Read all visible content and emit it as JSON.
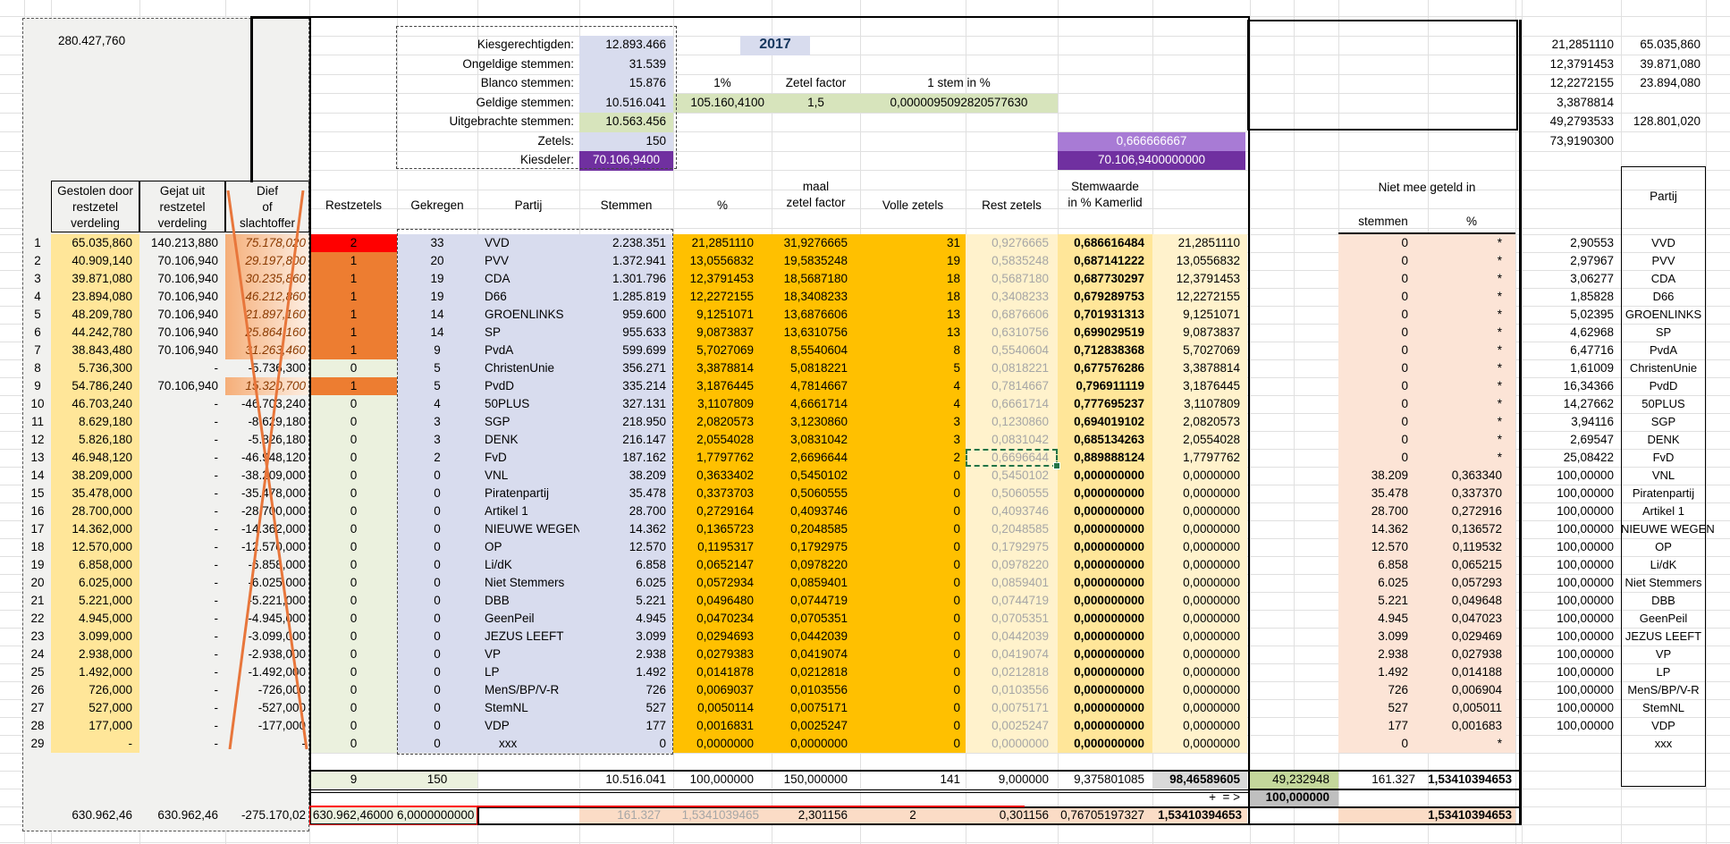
{
  "year": "2017",
  "top_left_value": "280.427,760",
  "info": {
    "rows": [
      {
        "label": "Kiesgerechtigden:",
        "value": "12.893.466",
        "bg": "lav"
      },
      {
        "label": "Ongeldige stemmen:",
        "value": "31.539",
        "bg": "lav"
      },
      {
        "label": "Blanco stemmen:",
        "value": "15.876",
        "bg": "lav"
      },
      {
        "label": "Geldige stemmen:",
        "value": "10.516.041",
        "bg": "lav"
      },
      {
        "label": "Uitgebrachte stemmen:",
        "value": "10.563.456",
        "bg": "green"
      },
      {
        "label": "Zetels:",
        "value": "150",
        "bg": "lav"
      },
      {
        "label": "Kiesdeler:",
        "value": "70.106,9400",
        "bg": "purple"
      }
    ],
    "pct_label": "1%",
    "pct_value": "105.160,4100",
    "factor_label": "Zetel factor",
    "factor_value": "1,5",
    "stem_label": "1 stem in %",
    "stem_value": "0,0000095092820577630",
    "purple_light": "0,666666667",
    "purple_dark": "70.106,9400000000"
  },
  "top_right": [
    [
      "21,2851110",
      "65.035,860"
    ],
    [
      "12,3791453",
      "39.871,080"
    ],
    [
      "12,2272155",
      "23.894,080"
    ],
    [
      "3,3878814",
      ""
    ],
    [
      "49,2793533",
      "128.801,020"
    ],
    [
      "73,9190300",
      ""
    ]
  ],
  "headers": {
    "left": [
      "Gestolen door\nrestzetel\nverdeling",
      "Gejat uit\nrestzetel\nverdeling",
      "Dief\nof\nslachtoffer"
    ],
    "restzetels": "Restzetels",
    "gekregen": "Gekregen",
    "partij": "Partij",
    "stemmen": "Stemmen",
    "pct": "%",
    "maal": "maal\nzetel factor",
    "volle": "Volle zetels",
    "rest": "Rest zetels",
    "stemwaarde": "Stemwaarde\nin % Kamerlid",
    "niet": "Niet mee geteld in",
    "niet_stemmen": "stemmen",
    "niet_pct": "%",
    "partij_right": "Partij"
  },
  "rows": [
    {
      "n": "1",
      "gestolen": "65.035,860",
      "gejat": "140.213,880",
      "dief": "75.178,020",
      "dief_bar": true,
      "restzetels": "2",
      "rz_color": "red",
      "gekregen": "33",
      "partij": "VVD",
      "stemmen": "2.238.351",
      "pct": "21,2851110",
      "maal": "31,9276665",
      "volle": "31",
      "rest": "0,9276665",
      "stemwaarde": "0,686616484",
      "pct2": "21,2851110",
      "nm_stemmen": "0",
      "nm_pct": "*",
      "num": "2,90553",
      "partij2": "VVD",
      "selected": false
    },
    {
      "n": "2",
      "gestolen": "40.909,140",
      "gejat": "70.106,940",
      "dief": "29.197,800",
      "dief_bar": true,
      "restzetels": "1",
      "rz_color": "orange",
      "gekregen": "20",
      "partij": "PVV",
      "stemmen": "1.372.941",
      "pct": "13,0556832",
      "maal": "19,5835248",
      "volle": "19",
      "rest": "0,5835248",
      "stemwaarde": "0,687141222",
      "pct2": "13,0556832",
      "nm_stemmen": "0",
      "nm_pct": "*",
      "num": "2,97967",
      "partij2": "PVV",
      "selected": false
    },
    {
      "n": "3",
      "gestolen": "39.871,080",
      "gejat": "70.106,940",
      "dief": "30.235,860",
      "dief_bar": true,
      "restzetels": "1",
      "rz_color": "orange",
      "gekregen": "19",
      "partij": "CDA",
      "stemmen": "1.301.796",
      "pct": "12,3791453",
      "maal": "18,5687180",
      "volle": "18",
      "rest": "0,5687180",
      "stemwaarde": "0,687730297",
      "pct2": "12,3791453",
      "nm_stemmen": "0",
      "nm_pct": "*",
      "num": "3,06277",
      "partij2": "CDA",
      "selected": false
    },
    {
      "n": "4",
      "gestolen": "23.894,080",
      "gejat": "70.106,940",
      "dief": "46.212,860",
      "dief_bar": true,
      "restzetels": "1",
      "rz_color": "orange",
      "gekregen": "19",
      "partij": "D66",
      "stemmen": "1.285.819",
      "pct": "12,2272155",
      "maal": "18,3408233",
      "volle": "18",
      "rest": "0,3408233",
      "stemwaarde": "0,679289753",
      "pct2": "12,2272155",
      "nm_stemmen": "0",
      "nm_pct": "*",
      "num": "1,85828",
      "partij2": "D66",
      "selected": false
    },
    {
      "n": "5",
      "gestolen": "48.209,780",
      "gejat": "70.106,940",
      "dief": "21.897,160",
      "dief_bar": true,
      "restzetels": "1",
      "rz_color": "orange",
      "gekregen": "14",
      "partij": "GROENLINKS",
      "stemmen": "959.600",
      "pct": "9,1251071",
      "maal": "13,6876606",
      "volle": "13",
      "rest": "0,6876606",
      "stemwaarde": "0,701931313",
      "pct2": "9,1251071",
      "nm_stemmen": "0",
      "nm_pct": "*",
      "num": "5,02395",
      "partij2": "GROENLINKS",
      "selected": false
    },
    {
      "n": "6",
      "gestolen": "44.242,780",
      "gejat": "70.106,940",
      "dief": "25.864,160",
      "dief_bar": true,
      "restzetels": "1",
      "rz_color": "orange",
      "gekregen": "14",
      "partij": "SP",
      "stemmen": "955.633",
      "pct": "9,0873837",
      "maal": "13,6310756",
      "volle": "13",
      "rest": "0,6310756",
      "stemwaarde": "0,699029519",
      "pct2": "9,0873837",
      "nm_stemmen": "0",
      "nm_pct": "*",
      "num": "4,62968",
      "partij2": "SP",
      "selected": false
    },
    {
      "n": "7",
      "gestolen": "38.843,480",
      "gejat": "70.106,940",
      "dief": "31.263,460",
      "dief_bar": true,
      "restzetels": "1",
      "rz_color": "orange",
      "gekregen": "9",
      "partij": "PvdA",
      "stemmen": "599.699",
      "pct": "5,7027069",
      "maal": "8,5540604",
      "volle": "8",
      "rest": "0,5540604",
      "stemwaarde": "0,712838368",
      "pct2": "5,7027069",
      "nm_stemmen": "0",
      "nm_pct": "*",
      "num": "6,47716",
      "partij2": "PvdA",
      "selected": false
    },
    {
      "n": "8",
      "gestolen": "5.736,300",
      "gejat": "-",
      "dief": "-5.736,300",
      "dief_bar": false,
      "restzetels": "0",
      "rz_color": "green",
      "gekregen": "5",
      "partij": "ChristenUnie",
      "stemmen": "356.271",
      "pct": "3,3878814",
      "maal": "5,0818221",
      "volle": "5",
      "rest": "0,0818221",
      "stemwaarde": "0,677576286",
      "pct2": "3,3878814",
      "nm_stemmen": "0",
      "nm_pct": "*",
      "num": "1,61009",
      "partij2": "ChristenUnie",
      "selected": false
    },
    {
      "n": "9",
      "gestolen": "54.786,240",
      "gejat": "70.106,940",
      "dief": "15.320,700",
      "dief_bar": true,
      "restzetels": "1",
      "rz_color": "orange",
      "gekregen": "5",
      "partij": "PvdD",
      "stemmen": "335.214",
      "pct": "3,1876445",
      "maal": "4,7814667",
      "volle": "4",
      "rest": "0,7814667",
      "stemwaarde": "0,796911119",
      "pct2": "3,1876445",
      "nm_stemmen": "0",
      "nm_pct": "*",
      "num": "16,34366",
      "partij2": "PvdD",
      "selected": false
    },
    {
      "n": "10",
      "gestolen": "46.703,240",
      "gejat": "-",
      "dief": "-46.703,240",
      "dief_bar": false,
      "restzetels": "0",
      "rz_color": "green",
      "gekregen": "4",
      "partij": "50PLUS",
      "stemmen": "327.131",
      "pct": "3,1107809",
      "maal": "4,6661714",
      "volle": "4",
      "rest": "0,6661714",
      "stemwaarde": "0,777695237",
      "pct2": "3,1107809",
      "nm_stemmen": "0",
      "nm_pct": "*",
      "num": "14,27662",
      "partij2": "50PLUS",
      "selected": false
    },
    {
      "n": "11",
      "gestolen": "8.629,180",
      "gejat": "-",
      "dief": "-8.629,180",
      "dief_bar": false,
      "restzetels": "0",
      "rz_color": "green",
      "gekregen": "3",
      "partij": "SGP",
      "stemmen": "218.950",
      "pct": "2,0820573",
      "maal": "3,1230860",
      "volle": "3",
      "rest": "0,1230860",
      "stemwaarde": "0,694019102",
      "pct2": "2,0820573",
      "nm_stemmen": "0",
      "nm_pct": "*",
      "num": "3,94116",
      "partij2": "SGP",
      "selected": false
    },
    {
      "n": "12",
      "gestolen": "5.826,180",
      "gejat": "-",
      "dief": "-5.826,180",
      "dief_bar": false,
      "restzetels": "0",
      "rz_color": "green",
      "gekregen": "3",
      "partij": "DENK",
      "stemmen": "216.147",
      "pct": "2,0554028",
      "maal": "3,0831042",
      "volle": "3",
      "rest": "0,0831042",
      "stemwaarde": "0,685134263",
      "pct2": "2,0554028",
      "nm_stemmen": "0",
      "nm_pct": "*",
      "num": "2,69547",
      "partij2": "DENK",
      "selected": false
    },
    {
      "n": "13",
      "gestolen": "46.948,120",
      "gejat": "-",
      "dief": "-46.948,120",
      "dief_bar": false,
      "restzetels": "0",
      "rz_color": "green",
      "gekregen": "2",
      "partij": "FvD",
      "stemmen": "187.162",
      "pct": "1,7797762",
      "maal": "2,6696644",
      "volle": "2",
      "rest": "0,6696644",
      "stemwaarde": "0,889888124",
      "pct2": "1,7797762",
      "nm_stemmen": "0",
      "nm_pct": "*",
      "num": "25,08422",
      "partij2": "FvD",
      "selected": true
    },
    {
      "n": "14",
      "gestolen": "38.209,000",
      "gejat": "-",
      "dief": "-38.209,000",
      "dief_bar": false,
      "restzetels": "0",
      "rz_color": "green",
      "gekregen": "0",
      "partij": "VNL",
      "stemmen": "38.209",
      "pct": "0,3633402",
      "maal": "0,5450102",
      "volle": "0",
      "rest": "0,5450102",
      "stemwaarde": "0,000000000",
      "pct2": "0,0000000",
      "nm_stemmen": "38.209",
      "nm_pct": "0,363340",
      "num": "100,00000",
      "partij2": "VNL",
      "selected": false
    },
    {
      "n": "15",
      "gestolen": "35.478,000",
      "gejat": "-",
      "dief": "-35.478,000",
      "dief_bar": false,
      "restzetels": "0",
      "rz_color": "green",
      "gekregen": "0",
      "partij": "Piratenpartij",
      "stemmen": "35.478",
      "pct": "0,3373703",
      "maal": "0,5060555",
      "volle": "0",
      "rest": "0,5060555",
      "stemwaarde": "0,000000000",
      "pct2": "0,0000000",
      "nm_stemmen": "35.478",
      "nm_pct": "0,337370",
      "num": "100,00000",
      "partij2": "Piratenpartij",
      "selected": false
    },
    {
      "n": "16",
      "gestolen": "28.700,000",
      "gejat": "-",
      "dief": "-28.700,000",
      "dief_bar": false,
      "restzetels": "0",
      "rz_color": "green",
      "gekregen": "0",
      "partij": "Artikel 1",
      "stemmen": "28.700",
      "pct": "0,2729164",
      "maal": "0,4093746",
      "volle": "0",
      "rest": "0,4093746",
      "stemwaarde": "0,000000000",
      "pct2": "0,0000000",
      "nm_stemmen": "28.700",
      "nm_pct": "0,272916",
      "num": "100,00000",
      "partij2": "Artikel 1",
      "selected": false
    },
    {
      "n": "17",
      "gestolen": "14.362,000",
      "gejat": "-",
      "dief": "-14.362,000",
      "dief_bar": false,
      "restzetels": "0",
      "rz_color": "green",
      "gekregen": "0",
      "partij": "NIEUWE WEGEN",
      "stemmen": "14.362",
      "pct": "0,1365723",
      "maal": "0,2048585",
      "volle": "0",
      "rest": "0,2048585",
      "stemwaarde": "0,000000000",
      "pct2": "0,0000000",
      "nm_stemmen": "14.362",
      "nm_pct": "0,136572",
      "num": "100,00000",
      "partij2": "NIEUWE WEGEN",
      "selected": false
    },
    {
      "n": "18",
      "gestolen": "12.570,000",
      "gejat": "-",
      "dief": "-12.570,000",
      "dief_bar": false,
      "restzetels": "0",
      "rz_color": "green",
      "gekregen": "0",
      "partij": "OP",
      "stemmen": "12.570",
      "pct": "0,1195317",
      "maal": "0,1792975",
      "volle": "0",
      "rest": "0,1792975",
      "stemwaarde": "0,000000000",
      "pct2": "0,0000000",
      "nm_stemmen": "12.570",
      "nm_pct": "0,119532",
      "num": "100,00000",
      "partij2": "OP",
      "selected": false
    },
    {
      "n": "19",
      "gestolen": "6.858,000",
      "gejat": "-",
      "dief": "-6.858,000",
      "dief_bar": false,
      "restzetels": "0",
      "rz_color": "green",
      "gekregen": "0",
      "partij": "Li/dK",
      "stemmen": "6.858",
      "pct": "0,0652147",
      "maal": "0,0978220",
      "volle": "0",
      "rest": "0,0978220",
      "stemwaarde": "0,000000000",
      "pct2": "0,0000000",
      "nm_stemmen": "6.858",
      "nm_pct": "0,065215",
      "num": "100,00000",
      "partij2": "Li/dK",
      "selected": false
    },
    {
      "n": "20",
      "gestolen": "6.025,000",
      "gejat": "-",
      "dief": "-6.025,000",
      "dief_bar": false,
      "restzetels": "0",
      "rz_color": "green",
      "gekregen": "0",
      "partij": "Niet Stemmers",
      "stemmen": "6.025",
      "pct": "0,0572934",
      "maal": "0,0859401",
      "volle": "0",
      "rest": "0,0859401",
      "stemwaarde": "0,000000000",
      "pct2": "0,0000000",
      "nm_stemmen": "6.025",
      "nm_pct": "0,057293",
      "num": "100,00000",
      "partij2": "Niet Stemmers",
      "selected": false
    },
    {
      "n": "21",
      "gestolen": "5.221,000",
      "gejat": "-",
      "dief": "-5.221,000",
      "dief_bar": false,
      "restzetels": "0",
      "rz_color": "green",
      "gekregen": "0",
      "partij": "DBB",
      "stemmen": "5.221",
      "pct": "0,0496480",
      "maal": "0,0744719",
      "volle": "0",
      "rest": "0,0744719",
      "stemwaarde": "0,000000000",
      "pct2": "0,0000000",
      "nm_stemmen": "5.221",
      "nm_pct": "0,049648",
      "num": "100,00000",
      "partij2": "DBB",
      "selected": false
    },
    {
      "n": "22",
      "gestolen": "4.945,000",
      "gejat": "-",
      "dief": "-4.945,000",
      "dief_bar": false,
      "restzetels": "0",
      "rz_color": "green",
      "gekregen": "0",
      "partij": "GeenPeil",
      "stemmen": "4.945",
      "pct": "0,0470234",
      "maal": "0,0705351",
      "volle": "0",
      "rest": "0,0705351",
      "stemwaarde": "0,000000000",
      "pct2": "0,0000000",
      "nm_stemmen": "4.945",
      "nm_pct": "0,047023",
      "num": "100,00000",
      "partij2": "GeenPeil",
      "selected": false
    },
    {
      "n": "23",
      "gestolen": "3.099,000",
      "gejat": "-",
      "dief": "-3.099,000",
      "dief_bar": false,
      "restzetels": "0",
      "rz_color": "green",
      "gekregen": "0",
      "partij": "JEZUS LEEFT",
      "stemmen": "3.099",
      "pct": "0,0294693",
      "maal": "0,0442039",
      "volle": "0",
      "rest": "0,0442039",
      "stemwaarde": "0,000000000",
      "pct2": "0,0000000",
      "nm_stemmen": "3.099",
      "nm_pct": "0,029469",
      "num": "100,00000",
      "partij2": "JEZUS LEEFT",
      "selected": false
    },
    {
      "n": "24",
      "gestolen": "2.938,000",
      "gejat": "-",
      "dief": "-2.938,000",
      "dief_bar": false,
      "restzetels": "0",
      "rz_color": "green",
      "gekregen": "0",
      "partij": "VP",
      "stemmen": "2.938",
      "pct": "0,0279383",
      "maal": "0,0419074",
      "volle": "0",
      "rest": "0,0419074",
      "stemwaarde": "0,000000000",
      "pct2": "0,0000000",
      "nm_stemmen": "2.938",
      "nm_pct": "0,027938",
      "num": "100,00000",
      "partij2": "VP",
      "selected": false
    },
    {
      "n": "25",
      "gestolen": "1.492,000",
      "gejat": "-",
      "dief": "-1.492,000",
      "dief_bar": false,
      "restzetels": "0",
      "rz_color": "green",
      "gekregen": "0",
      "partij": "LP",
      "stemmen": "1.492",
      "pct": "0,0141878",
      "maal": "0,0212818",
      "volle": "0",
      "rest": "0,0212818",
      "stemwaarde": "0,000000000",
      "pct2": "0,0000000",
      "nm_stemmen": "1.492",
      "nm_pct": "0,014188",
      "num": "100,00000",
      "partij2": "LP",
      "selected": false
    },
    {
      "n": "26",
      "gestolen": "726,000",
      "gejat": "-",
      "dief": "-726,000",
      "dief_bar": false,
      "restzetels": "0",
      "rz_color": "green",
      "gekregen": "0",
      "partij": "MenS/BP/V-R",
      "stemmen": "726",
      "pct": "0,0069037",
      "maal": "0,0103556",
      "volle": "0",
      "rest": "0,0103556",
      "stemwaarde": "0,000000000",
      "pct2": "0,0000000",
      "nm_stemmen": "726",
      "nm_pct": "0,006904",
      "num": "100,00000",
      "partij2": "MenS/BP/V-R",
      "selected": false
    },
    {
      "n": "27",
      "gestolen": "527,000",
      "gejat": "-",
      "dief": "-527,000",
      "dief_bar": false,
      "restzetels": "0",
      "rz_color": "green",
      "gekregen": "0",
      "partij": "StemNL",
      "stemmen": "527",
      "pct": "0,0050114",
      "maal": "0,0075171",
      "volle": "0",
      "rest": "0,0075171",
      "stemwaarde": "0,000000000",
      "pct2": "0,0000000",
      "nm_stemmen": "527",
      "nm_pct": "0,005011",
      "num": "100,00000",
      "partij2": "StemNL",
      "selected": false
    },
    {
      "n": "28",
      "gestolen": "177,000",
      "gejat": "-",
      "dief": "-177,000",
      "dief_bar": false,
      "restzetels": "0",
      "rz_color": "green",
      "gekregen": "0",
      "partij": "VDP",
      "stemmen": "177",
      "pct": "0,0016831",
      "maal": "0,0025247",
      "volle": "0",
      "rest": "0,0025247",
      "stemwaarde": "0,000000000",
      "pct2": "0,0000000",
      "nm_stemmen": "177",
      "nm_pct": "0,001683",
      "num": "100,00000",
      "partij2": "VDP",
      "selected": false
    },
    {
      "n": "29",
      "gestolen": "-",
      "gejat": "-",
      "dief": "-",
      "dief_bar": false,
      "restzetels": "0",
      "rz_color": "green",
      "gekregen": "0",
      "partij": "xxx",
      "stemmen": "0",
      "pct": "0,0000000",
      "maal": "0,0000000",
      "volle": "0",
      "rest": "0,0000000",
      "stemwaarde": "0,000000000",
      "pct2": "0,0000000",
      "nm_stemmen": "0",
      "nm_pct": "*",
      "num": "",
      "partij2": "xxx",
      "selected": false
    }
  ],
  "totals": {
    "restzetels": "9",
    "gekregen": "150",
    "stemmen": "10.516.041",
    "pct": "100,000000",
    "maal": "150,000000",
    "volle": "141",
    "rest": "9,000000",
    "stemwaarde": "9,375801085",
    "pct2": "98,46589605",
    "stemwaarde_sum": "49,232948",
    "nm_stemmen": "161.327",
    "nm_pct": "1,53410394653"
  },
  "plus_row": {
    "label": "+  = >",
    "value": "100,000000"
  },
  "bottom": {
    "gestolen": "630.962,46",
    "gejat": "630.962,46",
    "dief": "-275.170,02",
    "restzetels": "630.962,46000",
    "gekregen": "6,0000000000",
    "stemmen": "161.327",
    "pct": "1,5341039465",
    "maal": "2,301156",
    "volle": "2",
    "rest": "0,301156",
    "stemwaarde": "0,76705197327",
    "pct2": "1,53410394653",
    "nm_pct": "1,53410394653"
  },
  "colors": {
    "seat_full": "#FFC000",
    "rest_red": "#FF0000",
    "rest_orange": "#ED7D31",
    "rest_green": "#EBF1DE",
    "party_block": "#D8DCEE",
    "kiesdeler_purple": "#7030A0",
    "light_purple": "#A87BD5",
    "pink_block": "#FCE4D6",
    "info_green": "#D7E4BC",
    "x_lines": "#E8763B"
  }
}
